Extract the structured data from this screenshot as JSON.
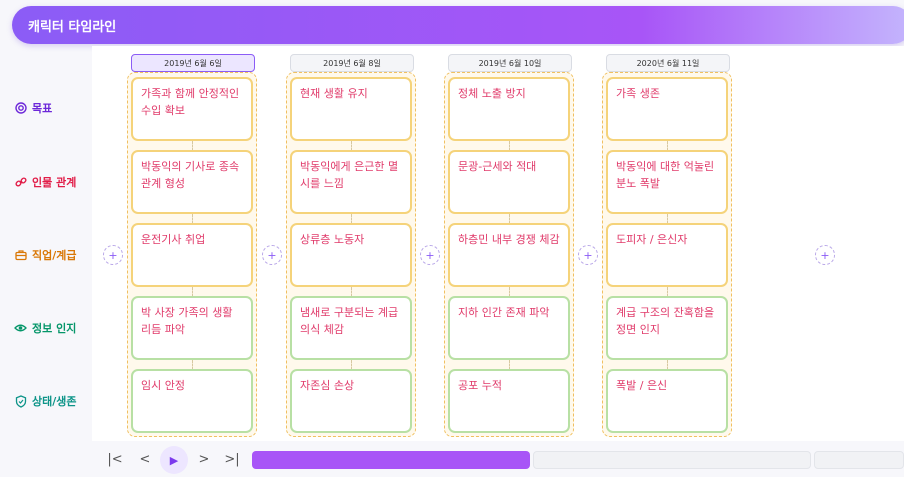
{
  "header": {
    "title": "캐릭터 타임라인"
  },
  "rows": [
    {
      "label": "목표",
      "color": "#6d28d9",
      "icon": "target-icon"
    },
    {
      "label": "인물 관계",
      "color": "#e11d48",
      "icon": "link-icon"
    },
    {
      "label": "직업/계급",
      "color": "#d97706",
      "icon": "briefcase-icon"
    },
    {
      "label": "정보 인지",
      "color": "#059669",
      "icon": "eye-icon"
    },
    {
      "label": "상태/생존",
      "color": "#0d9488",
      "icon": "shield-icon"
    }
  ],
  "columns": [
    {
      "date": "2019년 6월 6일",
      "active": true,
      "cells": [
        "가족과 함께 안정적인 수입 확보",
        "박동익의 기사로 종속 관계 형성",
        "운전기사 취업",
        "박 사장 가족의 생활 리듬 파악",
        "임시 안정"
      ]
    },
    {
      "date": "2019년 6월 8일",
      "active": false,
      "cells": [
        "현재 생활 유지",
        "박동익에게 은근한 멸시를 느낌",
        "상류층 노동자",
        "냄새로 구분되는 계급 의식 체감",
        "자존심 손상"
      ]
    },
    {
      "date": "2019년 6월 10일",
      "active": false,
      "cells": [
        "정체 노출 방지",
        "문광-근세와 적대",
        "하층민 내부 경쟁 체감",
        "지하 인간 존재 파악",
        "공포 누적"
      ]
    },
    {
      "date": "2020년 6월 11일",
      "active": false,
      "cells": [
        "가족 생존",
        "박동익에 대한 억눌린 분노 폭발",
        "도피자 / 은신자",
        "계급 구조의 잔혹함을 정면 인지",
        "폭발 / 은신"
      ]
    }
  ],
  "add_button_label": "+",
  "controls": {
    "first": "|<",
    "prev": "<",
    "play": "▶",
    "next": ">",
    "last": ">|"
  },
  "progress": 0.5,
  "colors": {
    "accent": "#8b5cf6",
    "card_text": "#e03a6a",
    "card_border_yellow": "#f5d37a",
    "card_border_green": "#b8e0a4"
  }
}
